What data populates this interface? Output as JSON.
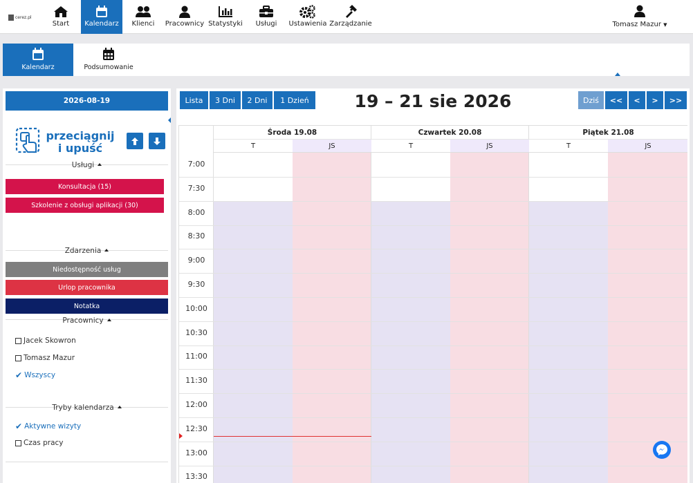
{
  "logo": {
    "text": "cerez.pl"
  },
  "nav": {
    "items": [
      {
        "label": "Start",
        "icon": "home-icon"
      },
      {
        "label": "Kalendarz",
        "icon": "calendar-icon"
      },
      {
        "label": "Klienci",
        "icon": "users-icon"
      },
      {
        "label": "Pracownicy",
        "icon": "user-icon"
      },
      {
        "label": "Statystyki",
        "icon": "chart-icon"
      },
      {
        "label": "Usługi",
        "icon": "briefcase-icon"
      },
      {
        "label": "Ustawienia",
        "icon": "cogs-icon"
      },
      {
        "label": "Zarządzanie",
        "icon": "hammer-icon"
      }
    ],
    "user": "Tomasz Mazur"
  },
  "subnav": {
    "items": [
      {
        "label": "Kalendarz",
        "icon": "calendar-icon"
      },
      {
        "label": "Podsumowanie",
        "icon": "calendar-grid-icon"
      }
    ]
  },
  "sidebar": {
    "date": "2026-08-19",
    "dnd_line1": "przeciągnij",
    "dnd_line2": "i upuść",
    "services_title": "Usługi",
    "services": [
      {
        "label": "Konsultacja (15)",
        "color": "#d4134b"
      },
      {
        "label": "Szkolenie z obsługi aplikacji (30)",
        "color": "#d4134b"
      }
    ],
    "events_title": "Zdarzenia",
    "events": [
      {
        "label": "Niedostępność usług",
        "color": "#7f7f7f"
      },
      {
        "label": "Urlop pracownika",
        "color": "#dd3344"
      },
      {
        "label": "Notatka",
        "color": "#0b1f66"
      }
    ],
    "employees_title": "Pracownicy",
    "employees": [
      {
        "label": "Jacek Skowron",
        "checked": false
      },
      {
        "label": "Tomasz Mazur",
        "checked": false
      },
      {
        "label": "Wszyscy",
        "checked": true
      }
    ],
    "modes_title": "Tryby kalendarza",
    "modes": [
      {
        "label": "Aktywne wizyty",
        "checked": true
      },
      {
        "label": "Czas pracy",
        "checked": false
      }
    ]
  },
  "calendar": {
    "views": [
      "Lista",
      "3 Dni",
      "2 Dni",
      "1 Dzień"
    ],
    "range_title": "19 – 21 sie 2026",
    "today_label": "Dziś",
    "nav_buttons": [
      "<<",
      "<",
      ">",
      ">>"
    ],
    "days": [
      {
        "label": "Środa 19.08",
        "subs": [
          "T",
          "JS"
        ]
      },
      {
        "label": "Czwartek 20.08",
        "subs": [
          "T",
          "JS"
        ]
      },
      {
        "label": "Piątek 21.08",
        "subs": [
          "T",
          "JS"
        ]
      }
    ],
    "times": [
      "7:00",
      "7:30",
      "8:00",
      "8:30",
      "9:00",
      "9:30",
      "10:00",
      "10:30",
      "11:00",
      "11:30",
      "12:00",
      "12:30",
      "13:00",
      "13:30"
    ],
    "colors": {
      "t_col": "#e6e2f3",
      "js_col": "#f8dde3",
      "js_head": "#efe9fb",
      "accent": "#1a6fbb"
    }
  }
}
